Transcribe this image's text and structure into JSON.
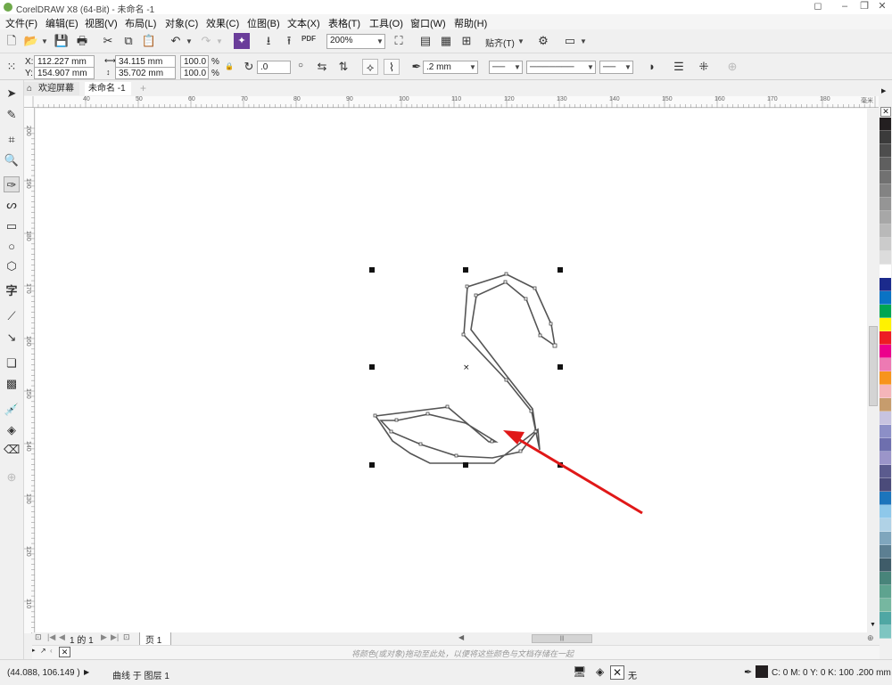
{
  "window": {
    "title": "CorelDRAW X8 (64-Bit) - 未命名 -1"
  },
  "menu": [
    "文件(F)",
    "编辑(E)",
    "视图(V)",
    "布局(L)",
    "对象(C)",
    "效果(C)",
    "位图(B)",
    "文本(X)",
    "表格(T)",
    "工具(O)",
    "窗口(W)",
    "帮助(H)"
  ],
  "toolbar": {
    "zoom": "200%",
    "pdf_label": "PDF",
    "snap_label": "贴齐(T)"
  },
  "property_bar": {
    "x_label": "X:",
    "x_value": "112.227 mm",
    "y_label": "Y:",
    "y_value": "154.907 mm",
    "w_value": "34.115 mm",
    "h_value": "35.702 mm",
    "scale_x": "100.0",
    "scale_y": "100.0",
    "pct": "%",
    "angle": ".0",
    "outline_width": ".2 mm"
  },
  "tabs": {
    "welcome": "欢迎屏幕",
    "doc": "未命名 -1"
  },
  "ruler_top": [
    "40",
    "50",
    "60",
    "70",
    "80",
    "90",
    "100",
    "110",
    "120",
    "130",
    "140",
    "150",
    "160",
    "170",
    "180"
  ],
  "ruler_top_unit": "毫米",
  "ruler_left": [
    "200",
    "190",
    "180",
    "170",
    "160",
    "150",
    "140",
    "130",
    "120",
    "110"
  ],
  "pagebar": {
    "page_info": "1 的 1",
    "page_tab": "页 1"
  },
  "colorbar_hint": "将颜色(或对象)拖动至此处，以便将这些颜色与文档存储在一起",
  "status": {
    "coords": "(44.088, 106.149 )",
    "object_info": "曲线 于 图层 1",
    "fill_none": "无",
    "outline_info": "C: 0 M: 0 Y: 0 K: 100  .200 mm"
  },
  "palette": [
    "#231f20",
    "#3b3b3b",
    "#4d4d4d",
    "#5f5f5f",
    "#717171",
    "#838383",
    "#959595",
    "#a7a7a7",
    "#b9b9b9",
    "#cbcbcb",
    "#dcdcdc",
    "#ffffff",
    "#1b2a8c",
    "#0a73c4",
    "#00a651",
    "#fff200",
    "#ed1c24",
    "#ec008c",
    "#ed7ab3",
    "#f7941d",
    "#f5b5b9",
    "#c69c6d",
    "#c7c3e0",
    "#8c8fc7",
    "#6e6fae",
    "#9b95c9",
    "#5b5b8e",
    "#4b4b7a",
    "#1c75bc",
    "#8ec8ea",
    "#b0d2e6",
    "#7fa6bd",
    "#5c7f92",
    "#3f5c69",
    "#48847a",
    "#5ea38f",
    "#76b7a0",
    "#4fa7a4",
    "#7ec5c1"
  ],
  "colors": {
    "accent_tab": "#ffffff",
    "arrow": "#e01818"
  }
}
